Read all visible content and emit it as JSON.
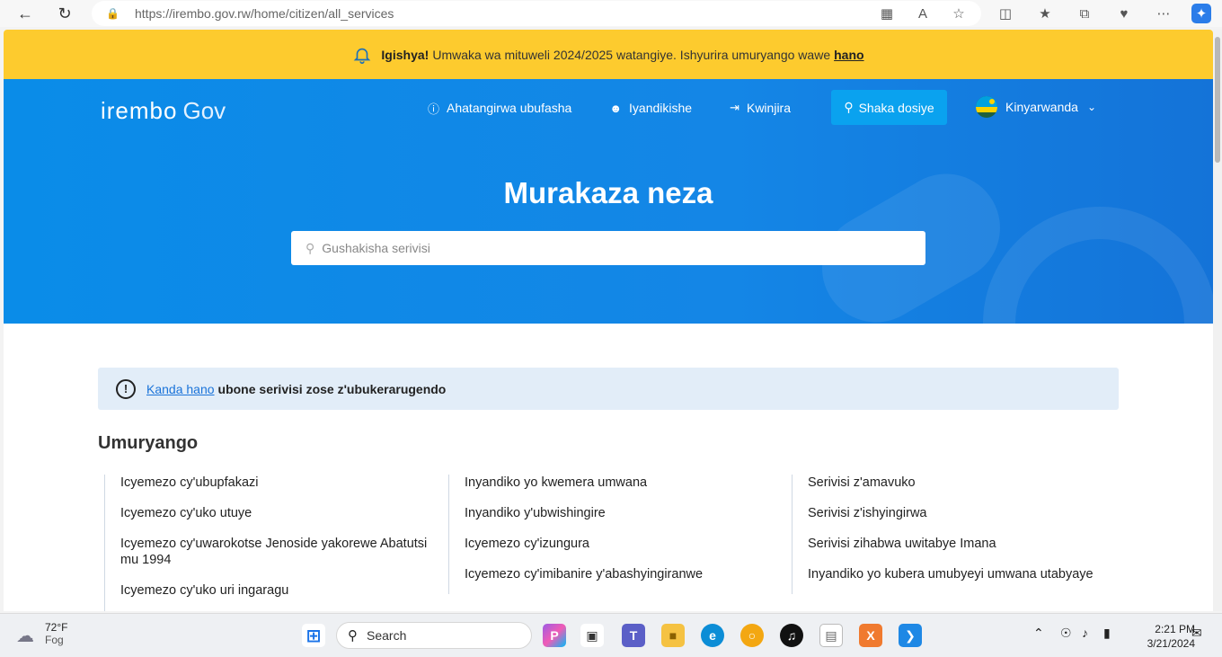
{
  "browser": {
    "url": "https://irembo.gov.rw/home/citizen/all_services"
  },
  "alert": {
    "bold": "Igishya!",
    "text": "Umwaka wa mituweli 2024/2025 watangiye. Ishyurira umuryango wawe",
    "link": "hano"
  },
  "header": {
    "logo_brand": "irembo",
    "logo_gov": "Gov",
    "nav": {
      "help": "Ahatangirwa ubufasha",
      "register": "Iyandikishe",
      "login": "Kwinjira",
      "search_file": "Shaka dosiye"
    },
    "language": "Kinyarwanda"
  },
  "hero": {
    "title": "Murakaza neza",
    "search_placeholder": "Gushakisha serivisi"
  },
  "info": {
    "link": "Kanda hano",
    "text": "ubone serivisi zose z'ubukerarugendo"
  },
  "section": {
    "title": "Umuryango",
    "col1": [
      "Icyemezo cy'ubupfakazi",
      "Icyemezo cy'uko utuye",
      "Icyemezo cy'uwarokotse Jenoside yakorewe Abatutsi mu 1994",
      "Icyemezo cy'uko uri ingaragu"
    ],
    "col2": [
      "Inyandiko yo kwemera umwana",
      "Inyandiko y'ubwishingire",
      "Icyemezo cy'izungura",
      "Icyemezo cy'imibanire y'abashyingiranwe"
    ],
    "col3": [
      "Serivisi z'amavuko",
      "Serivisi z'ishyingirwa",
      "Serivisi zihabwa uwitabye Imana",
      "Inyandiko yo kubera umubyeyi umwana utabyaye"
    ]
  },
  "taskbar": {
    "temp": "72°F",
    "weather": "Fog",
    "search": "Search",
    "time": "2:21 PM",
    "date": "3/21/2024"
  },
  "colors": {
    "alert_bg": "#fdcb2e",
    "hero_bg": "#0a8ce8",
    "button_bg": "#0aa2ef"
  }
}
